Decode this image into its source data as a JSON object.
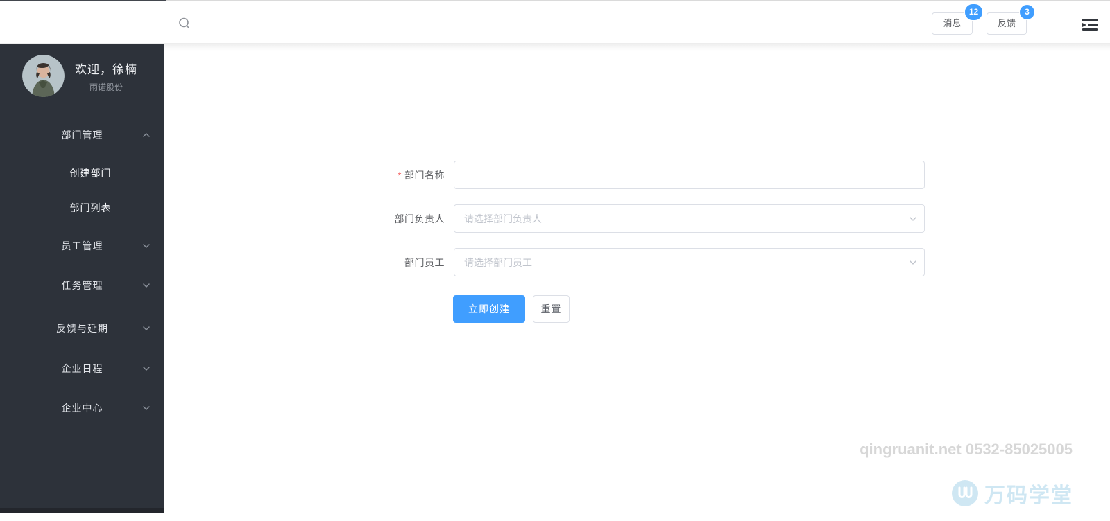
{
  "header": {
    "buttons": [
      {
        "label": "消息",
        "badge": "12"
      },
      {
        "label": "反馈",
        "badge": "3"
      }
    ]
  },
  "sidebar": {
    "welcome": "欢迎，徐楠",
    "company": "雨诺股份",
    "items": [
      {
        "label": "部门管理",
        "level": 1,
        "state": "expanded"
      },
      {
        "label": "创建部门",
        "level": 2,
        "active": true
      },
      {
        "label": "部门列表",
        "level": 2,
        "active": false
      },
      {
        "label": "员工管理",
        "level": 1,
        "state": "collapsed"
      },
      {
        "label": "任务管理",
        "level": 1,
        "state": "collapsed"
      },
      {
        "label": "反馈与延期",
        "level": 1,
        "state": "collapsed"
      },
      {
        "label": "企业日程",
        "level": 1,
        "state": "collapsed"
      },
      {
        "label": "企业中心",
        "level": 1,
        "state": "collapsed"
      }
    ]
  },
  "form": {
    "required_mark": "*",
    "fields": [
      {
        "label": "部门名称",
        "required": true,
        "type": "text",
        "value": "",
        "placeholder": ""
      },
      {
        "label": "部门负责人",
        "required": false,
        "type": "select",
        "value": "",
        "placeholder": "请选择部门负责人"
      },
      {
        "label": "部门员工",
        "required": false,
        "type": "select",
        "value": "",
        "placeholder": "请选择部门员工"
      }
    ],
    "submit_label": "立即创建",
    "reset_label": "重置"
  },
  "watermark": {
    "line": "qingruanit.net 0532-85025005",
    "brand": "万码学堂"
  },
  "colors": {
    "primary": "#409eff",
    "badge": "#409eff",
    "sidebar_bg": "#2d323a",
    "required_mark": "#f56c6c",
    "input_border": "#dcdfe6",
    "placeholder": "#c0c4cc",
    "label_text": "#606266",
    "watermark_text": "#d7d7d7",
    "brand_blue": "#cfe7f3"
  }
}
